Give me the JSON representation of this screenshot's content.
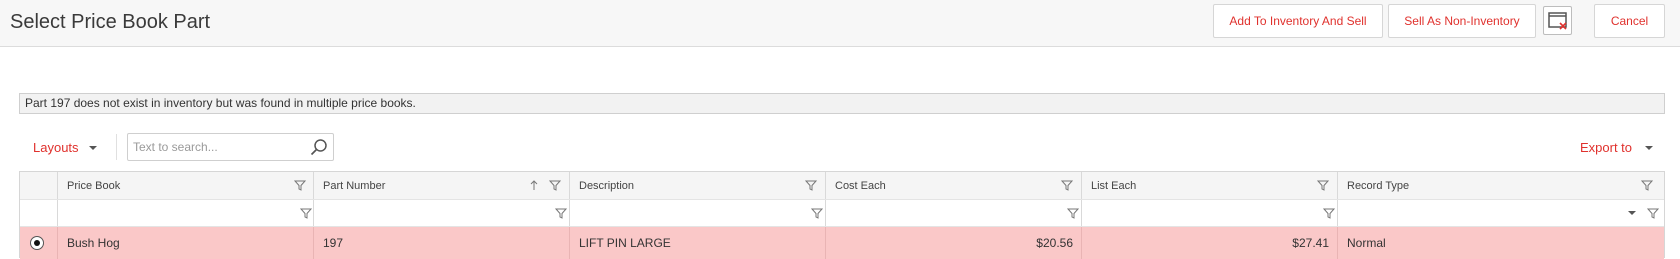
{
  "header": {
    "title": "Select Price Book Part",
    "buttons": {
      "add_to_inventory": "Add To Inventory And Sell",
      "sell_non_inventory": "Sell As Non-Inventory",
      "cancel": "Cancel"
    }
  },
  "message": "Part 197 does not exist in inventory but was found in multiple price books.",
  "toolbar": {
    "layouts_label": "Layouts",
    "search_placeholder": "Text to search...",
    "export_label": "Export to"
  },
  "grid": {
    "columns": [
      "Price Book",
      "Part Number",
      "Description",
      "Cost Each",
      "List Each",
      "Record Type"
    ],
    "sorted_column": "Part Number",
    "sort_direction": "ascending",
    "rows": [
      {
        "selected": true,
        "price_book": "Bush Hog",
        "part_number": "197",
        "description": "LIFT PIN LARGE",
        "cost_each": "$20.56",
        "list_each": "$27.41",
        "record_type": "Normal"
      }
    ]
  },
  "colors": {
    "accent": "#e0312d",
    "selected_row": "#fac8c8"
  },
  "icons": [
    "search-icon",
    "filter-icon",
    "sort-up-icon",
    "chevron-down-icon",
    "window-close-icon"
  ]
}
